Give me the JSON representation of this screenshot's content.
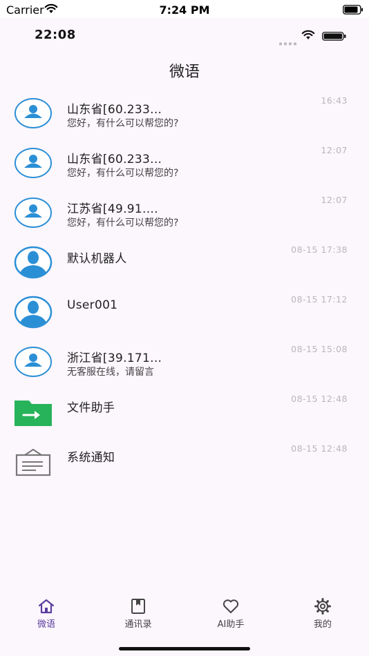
{
  "system_status": {
    "carrier": "Carrier",
    "time": "7:24 PM"
  },
  "app_status": {
    "time": "22:08"
  },
  "header": {
    "title": "微语"
  },
  "chats": [
    {
      "name": "山东省[60.233...",
      "preview": "您好，有什么可以帮您的?",
      "time": "16:43",
      "avatar": "user-circle-icon"
    },
    {
      "name": "山东省[60.233...",
      "preview": "您好，有什么可以帮您的?",
      "time": "12:07",
      "avatar": "user-circle-icon"
    },
    {
      "name": "江苏省[49.91....",
      "preview": "您好，有什么可以帮您的?",
      "time": "12:07",
      "avatar": "user-circle-icon"
    },
    {
      "name": "默认机器人",
      "preview": "",
      "time": "08-15 17:38",
      "avatar": "user-silhouette-icon"
    },
    {
      "name": "User001",
      "preview": "",
      "time": "08-15 17:12",
      "avatar": "user-silhouette-icon"
    },
    {
      "name": "浙江省[39.171...",
      "preview": "无客服在线，请留言",
      "time": "08-15 15:08",
      "avatar": "user-circle-icon"
    },
    {
      "name": "文件助手",
      "preview": "",
      "time": "08-15 12:48",
      "avatar": "folder-arrow-icon"
    },
    {
      "name": "系统通知",
      "preview": "",
      "time": "08-15 12:48",
      "avatar": "notice-board-icon"
    }
  ],
  "tabs": [
    {
      "label": "微语",
      "icon": "home-icon",
      "active": true
    },
    {
      "label": "通讯录",
      "icon": "contacts-book-icon",
      "active": false
    },
    {
      "label": "AI助手",
      "icon": "heart-icon",
      "active": false
    },
    {
      "label": "我的",
      "icon": "gear-icon",
      "active": false
    }
  ],
  "colors": {
    "background": "#fcf6fd",
    "avatar_blue": "#2b8fd6",
    "folder_green": "#27b35a",
    "active_tab": "#5b3e9e",
    "time_gray": "#b8b8b8"
  }
}
